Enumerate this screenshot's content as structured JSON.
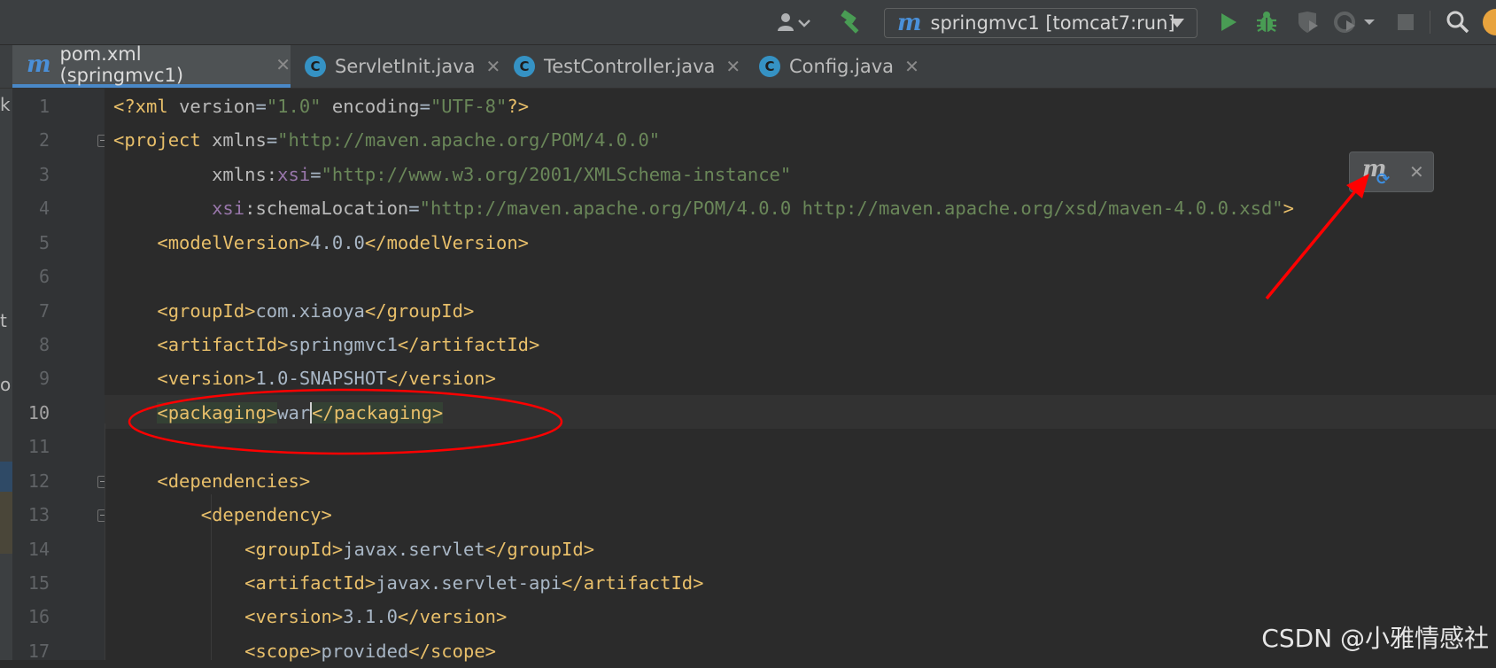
{
  "toolbar": {
    "user_icon": "user-icon",
    "build_icon": "hammer-icon",
    "run_config_label": "springmvc1 [tomcat7:run]",
    "run_config_logo": "m",
    "run_icon": "play-icon",
    "debug_icon": "bug-icon",
    "coverage_icon": "coverage-icon",
    "profile_icon": "profile-icon",
    "stop_icon": "stop-icon",
    "search_icon": "search-icon"
  },
  "tabs": [
    {
      "label": "pom.xml (springmvc1)",
      "icon": "maven-icon",
      "logo": "m",
      "active": true
    },
    {
      "label": "ServletInit.java",
      "icon": "class-icon",
      "logo": "C",
      "active": false
    },
    {
      "label": "TestController.java",
      "icon": "class-icon",
      "logo": "C",
      "active": false
    },
    {
      "label": "Config.java",
      "icon": "class-icon",
      "logo": "C",
      "active": false
    }
  ],
  "tab_close_glyph": "✕",
  "left_edge_chars": [
    "k",
    "t",
    "o"
  ],
  "editor": {
    "current_line": 10,
    "line_numbers": [
      "1",
      "2",
      "3",
      "4",
      "5",
      "6",
      "7",
      "8",
      "9",
      "10",
      "11",
      "12",
      "13",
      "14",
      "15",
      "16",
      "17"
    ]
  },
  "maven_popup": {
    "logo": "m",
    "sync_glyph": "⟳",
    "close_glyph": "✕"
  },
  "watermark": "CSDN @小雅情感社",
  "colors": {
    "tag": "#e8bf6a",
    "attribute_value": "#6a8759",
    "namespace": "#9876aa",
    "annotation_red": "#ff0000",
    "active_tab_underline": "#4a88c7"
  }
}
